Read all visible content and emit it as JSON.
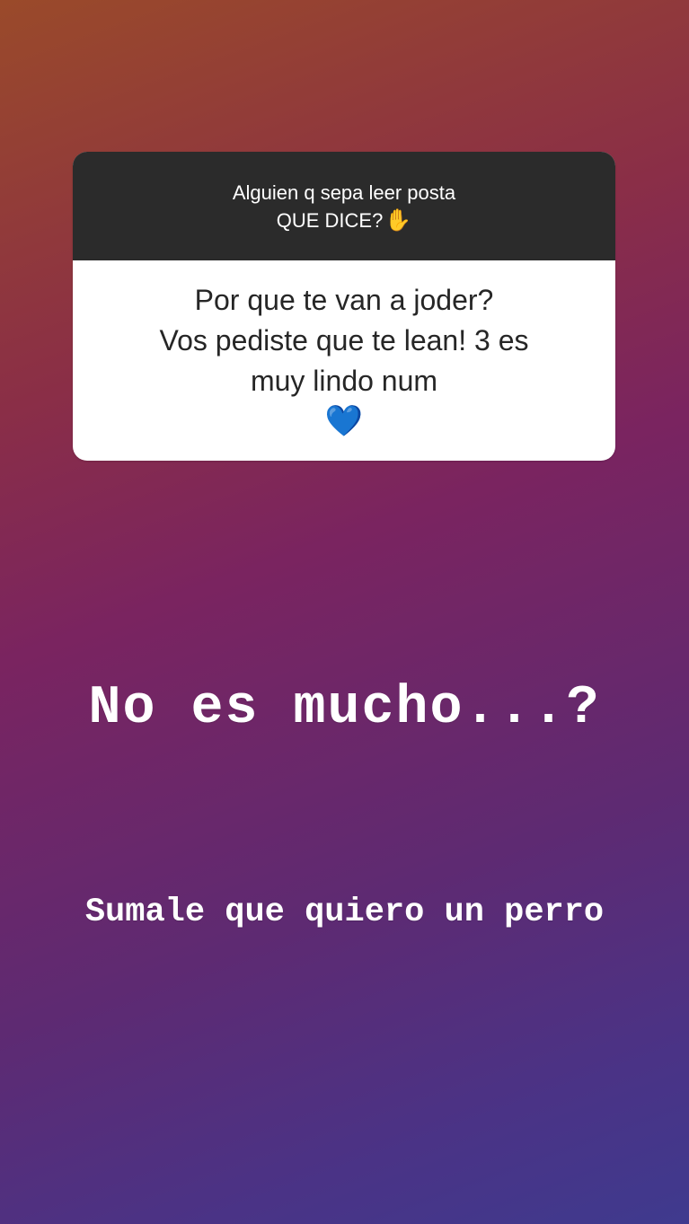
{
  "question_sticker": {
    "question_line1": "Alguien q sepa leer posta",
    "question_line2": "QUE DICE?",
    "question_emoji": "✋",
    "answer_line1": "Por que te van a joder?",
    "answer_line2": "Vos pediste que te lean! 3 es",
    "answer_line3": "muy lindo num",
    "answer_emoji": "💙"
  },
  "story_text": {
    "line_big": "No es mucho...?",
    "line_small": "Sumale que quiero un perro"
  },
  "colors": {
    "card_header": "#2b2b2b",
    "card_body": "#ffffff",
    "gradient_top": "#9a4a2a",
    "gradient_bottom": "#3f3a8e"
  }
}
